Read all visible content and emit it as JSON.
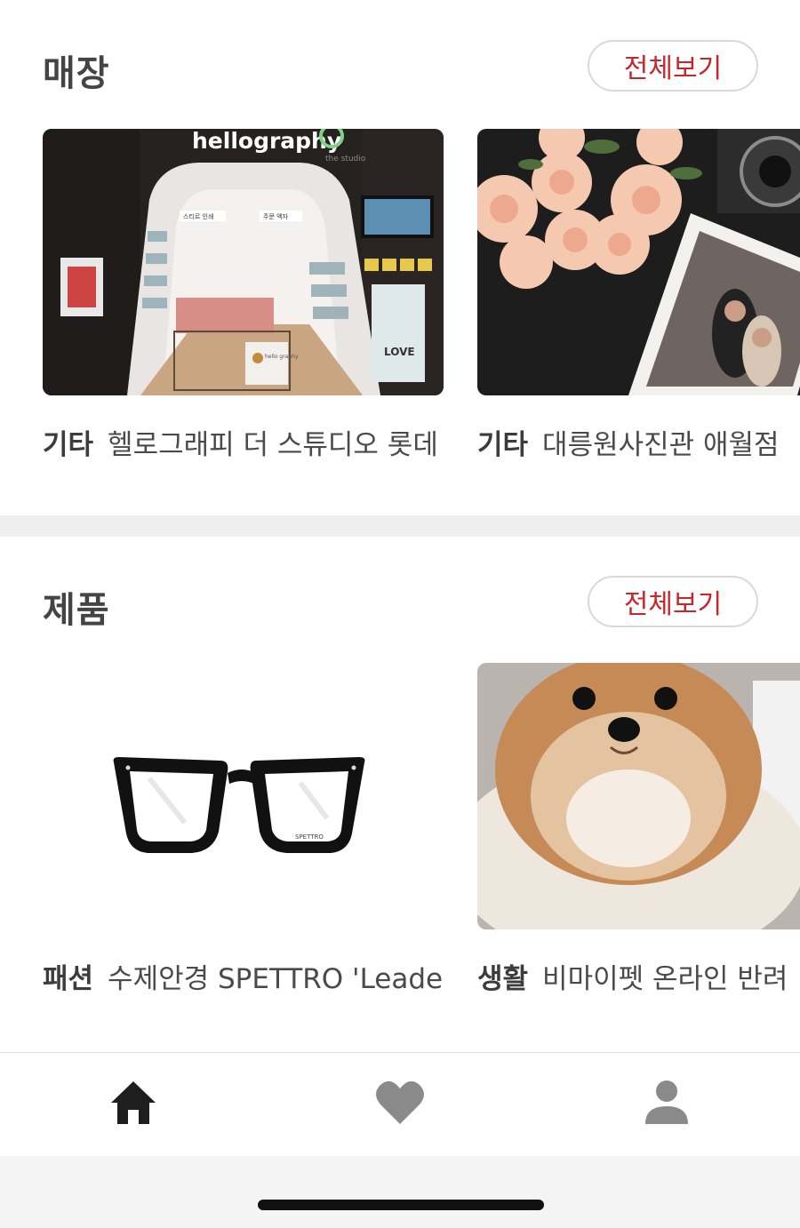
{
  "stores": {
    "title": "매장",
    "view_all": "전체보기",
    "cards": [
      {
        "category": "기타",
        "name": "헬로그래피 더 스튜디오 롯데",
        "image_text": {
          "brand_logo": "hellography",
          "brand_sub": "the studio",
          "sign_1": "스티르 인쇄",
          "sign_2": "주문 액자",
          "love_sign": "LOVE",
          "counter_logo": "hello graphy"
        }
      },
      {
        "category": "기타",
        "name": "대릉원사진관 애월점"
      }
    ]
  },
  "products": {
    "title": "제품",
    "view_all": "전체보기",
    "cards": [
      {
        "category": "패션",
        "name": "수제안경 SPETTRO 'Leader'",
        "image_text": {
          "lens_mark": "SPETTRO"
        }
      },
      {
        "category": "생활",
        "name": "비마이펫 온라인 반려"
      }
    ]
  },
  "tabbar": {
    "items": [
      "home-icon",
      "heart-icon",
      "profile-icon"
    ],
    "active_color": "#1e1e1e",
    "inactive_color": "#8a8a8a"
  },
  "accent_color": "#c8262a"
}
